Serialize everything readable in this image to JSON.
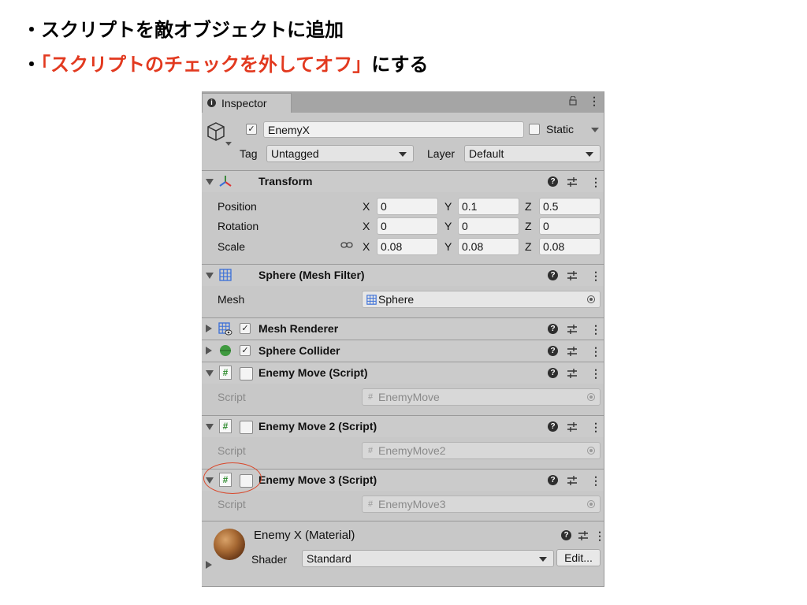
{
  "slide": {
    "bullet1": "・スクリプトを敵オブジェクトに追加",
    "bullet2_prefix": "・",
    "bullet2_red": "「スクリプトのチェックを外してオフ」",
    "bullet2_suffix": "にする"
  },
  "inspector": {
    "tab_label": "Inspector",
    "object_name": "EnemyX",
    "static_label": "Static",
    "tag_label": "Tag",
    "tag_value": "Untagged",
    "layer_label": "Layer",
    "layer_value": "Default",
    "transform": {
      "title": "Transform",
      "position_label": "Position",
      "rotation_label": "Rotation",
      "scale_label": "Scale",
      "axis_x": "X",
      "axis_y": "Y",
      "axis_z": "Z",
      "position": {
        "x": "0",
        "y": "0.1",
        "z": "0.5"
      },
      "rotation": {
        "x": "0",
        "y": "0",
        "z": "0"
      },
      "scale": {
        "x": "0.08",
        "y": "0.08",
        "z": "0.08"
      }
    },
    "mesh_filter": {
      "title": "Sphere (Mesh Filter)",
      "mesh_label": "Mesh",
      "mesh_value": "Sphere"
    },
    "mesh_renderer": {
      "title": "Mesh Renderer"
    },
    "sphere_collider": {
      "title": "Sphere Collider"
    },
    "scripts": [
      {
        "title": "Enemy Move (Script)",
        "field_label": "Script",
        "value": "EnemyMove"
      },
      {
        "title": "Enemy Move 2 (Script)",
        "field_label": "Script",
        "value": "EnemyMove2"
      },
      {
        "title": "Enemy Move 3 (Script)",
        "field_label": "Script",
        "value": "EnemyMove3"
      }
    ],
    "material": {
      "title": "Enemy X (Material)",
      "shader_label": "Shader",
      "shader_value": "Standard",
      "edit_label": "Edit..."
    }
  },
  "icons": {
    "help": "help-icon",
    "preset": "preset-icon",
    "menu": "kebab-icon",
    "script": "csharp-script-icon",
    "annotation_color": "#d9482b",
    "highlight_text_color": "#e2391f"
  }
}
